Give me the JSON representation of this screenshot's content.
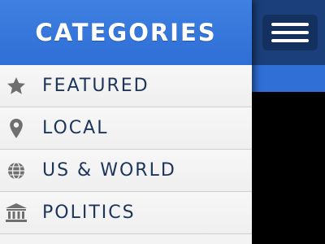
{
  "drawer": {
    "title": "CATEGORIES",
    "items": [
      {
        "label": "FEATURED",
        "icon": "star-icon"
      },
      {
        "label": "LOCAL",
        "icon": "location-pin-icon"
      },
      {
        "label": "US & WORLD",
        "icon": "globe-icon"
      },
      {
        "label": "POLITICS",
        "icon": "government-building-icon"
      }
    ]
  },
  "colors": {
    "header_blue": "#2f6fd6",
    "nav_dark": "#1b3f7a",
    "button_dark": "#14305f",
    "label_navy": "#1d3559",
    "icon_gray": "#6f6f6f"
  },
  "hamburger": {
    "icon": "hamburger-menu-icon"
  }
}
